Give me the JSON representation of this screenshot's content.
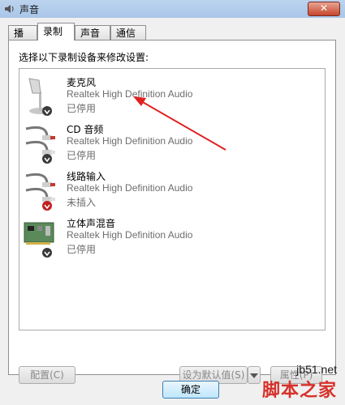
{
  "window": {
    "title": "声音",
    "close_label": "✕"
  },
  "tabs": [
    {
      "label": "播放",
      "active": false
    },
    {
      "label": "录制",
      "active": true
    },
    {
      "label": "声音",
      "active": false
    },
    {
      "label": "通信",
      "active": false
    }
  ],
  "instruction": "选择以下录制设备来修改设置:",
  "devices": [
    {
      "name": "麦克风",
      "driver": "Realtek High Definition Audio",
      "status": "已停用",
      "icon": "microphone-icon"
    },
    {
      "name": "CD 音频",
      "driver": "Realtek High Definition Audio",
      "status": "已停用",
      "icon": "rca-cable-icon"
    },
    {
      "name": "线路输入",
      "driver": "Realtek High Definition Audio",
      "status": "未插入",
      "icon": "rca-cable-icon"
    },
    {
      "name": "立体声混音",
      "driver": "Realtek High Definition Audio",
      "status": "已停用",
      "icon": "sound-card-icon"
    }
  ],
  "buttons": {
    "configure": "配置(C)",
    "set_default": "设为默认值(S)",
    "properties": "属性(P)",
    "ok": "确定"
  },
  "watermark": {
    "url": "jb51.net",
    "brand": "脚本之家"
  },
  "colors": {
    "arrow": "#e02020",
    "status_down": "#404040",
    "status_unplugged": "#c02020"
  }
}
